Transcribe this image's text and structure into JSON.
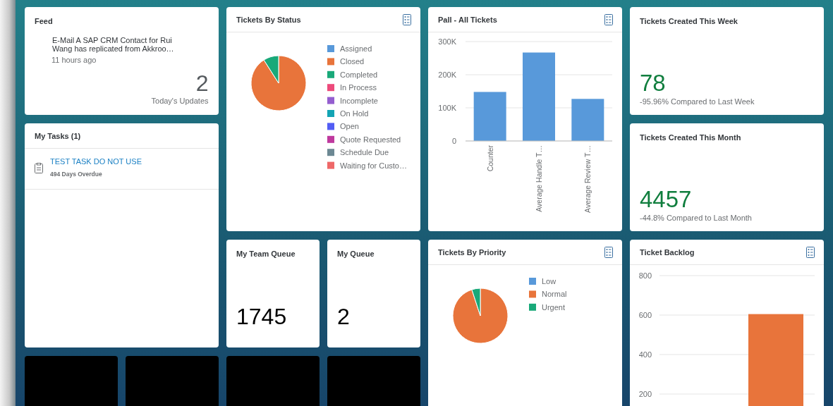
{
  "feed": {
    "title": "Feed",
    "message": "E-Mail A SAP CRM Contact for Rui Wang has replicated from Akkroo…",
    "time": "11 hours ago",
    "count": "2",
    "count_label": "Today's Updates"
  },
  "my_tasks": {
    "title": "My Tasks (1)",
    "items": [
      {
        "title": "TEST TASK DO NOT USE",
        "due": "494 Days Overdue"
      }
    ]
  },
  "tickets_by_status": {
    "title": "Tickets By Status",
    "legend": [
      {
        "label": "Assigned",
        "color": "#5899da"
      },
      {
        "label": "Closed",
        "color": "#e8743b"
      },
      {
        "label": "Completed",
        "color": "#19a979"
      },
      {
        "label": "In Process",
        "color": "#ed4a7b"
      },
      {
        "label": "Incomplete",
        "color": "#945ecf"
      },
      {
        "label": "On Hold",
        "color": "#13a4b4"
      },
      {
        "label": "Open",
        "color": "#525df4"
      },
      {
        "label": "Quote Requested",
        "color": "#bf399e"
      },
      {
        "label": "Schedule Due",
        "color": "#6c8893"
      },
      {
        "label": "Waiting for Custo…",
        "color": "#ee6868"
      }
    ]
  },
  "pall_all_tickets": {
    "title": "Pall - All Tickets",
    "chart_data": {
      "type": "bar",
      "categories": [
        "Counter",
        "Average Handle T…",
        "Average Review T…"
      ],
      "values": [
        148000,
        267000,
        127000
      ],
      "grid": true,
      "ylim": [
        0,
        300000
      ],
      "yticks": [
        {
          "value": 0,
          "label": "0"
        },
        {
          "value": 100000,
          "label": "100K"
        },
        {
          "value": 200000,
          "label": "200K"
        },
        {
          "value": 300000,
          "label": "300K"
        }
      ]
    }
  },
  "tickets_created_this_week": {
    "title": "Tickets Created This Week",
    "value": "78",
    "comparison": "-95.96% Compared to Last Week"
  },
  "tickets_created_this_month": {
    "title": "Tickets Created This Month",
    "value": "4457",
    "comparison": "-44.8% Compared to Last Month"
  },
  "my_team_queue": {
    "title": "My Team Queue",
    "value": "1745"
  },
  "my_queue": {
    "title": "My Queue",
    "value": "2"
  },
  "tickets_by_priority": {
    "title": "Tickets By Priority",
    "legend": [
      {
        "label": "Low",
        "color": "#5899da"
      },
      {
        "label": "Normal",
        "color": "#e8743b"
      },
      {
        "label": "Urgent",
        "color": "#19a979"
      }
    ]
  },
  "ticket_backlog": {
    "title": "Ticket Backlog",
    "chart_data": {
      "type": "bar",
      "values": [
        null,
        605
      ],
      "grid": true,
      "ylim": [
        0,
        800
      ],
      "yticks": [
        200,
        400,
        600,
        800
      ]
    }
  },
  "hidden_tiles": [
    {
      "kind": "blacked-out"
    },
    {
      "kind": "blacked-out"
    },
    {
      "kind": "blacked-out"
    },
    {
      "kind": "blacked-out"
    }
  ]
}
